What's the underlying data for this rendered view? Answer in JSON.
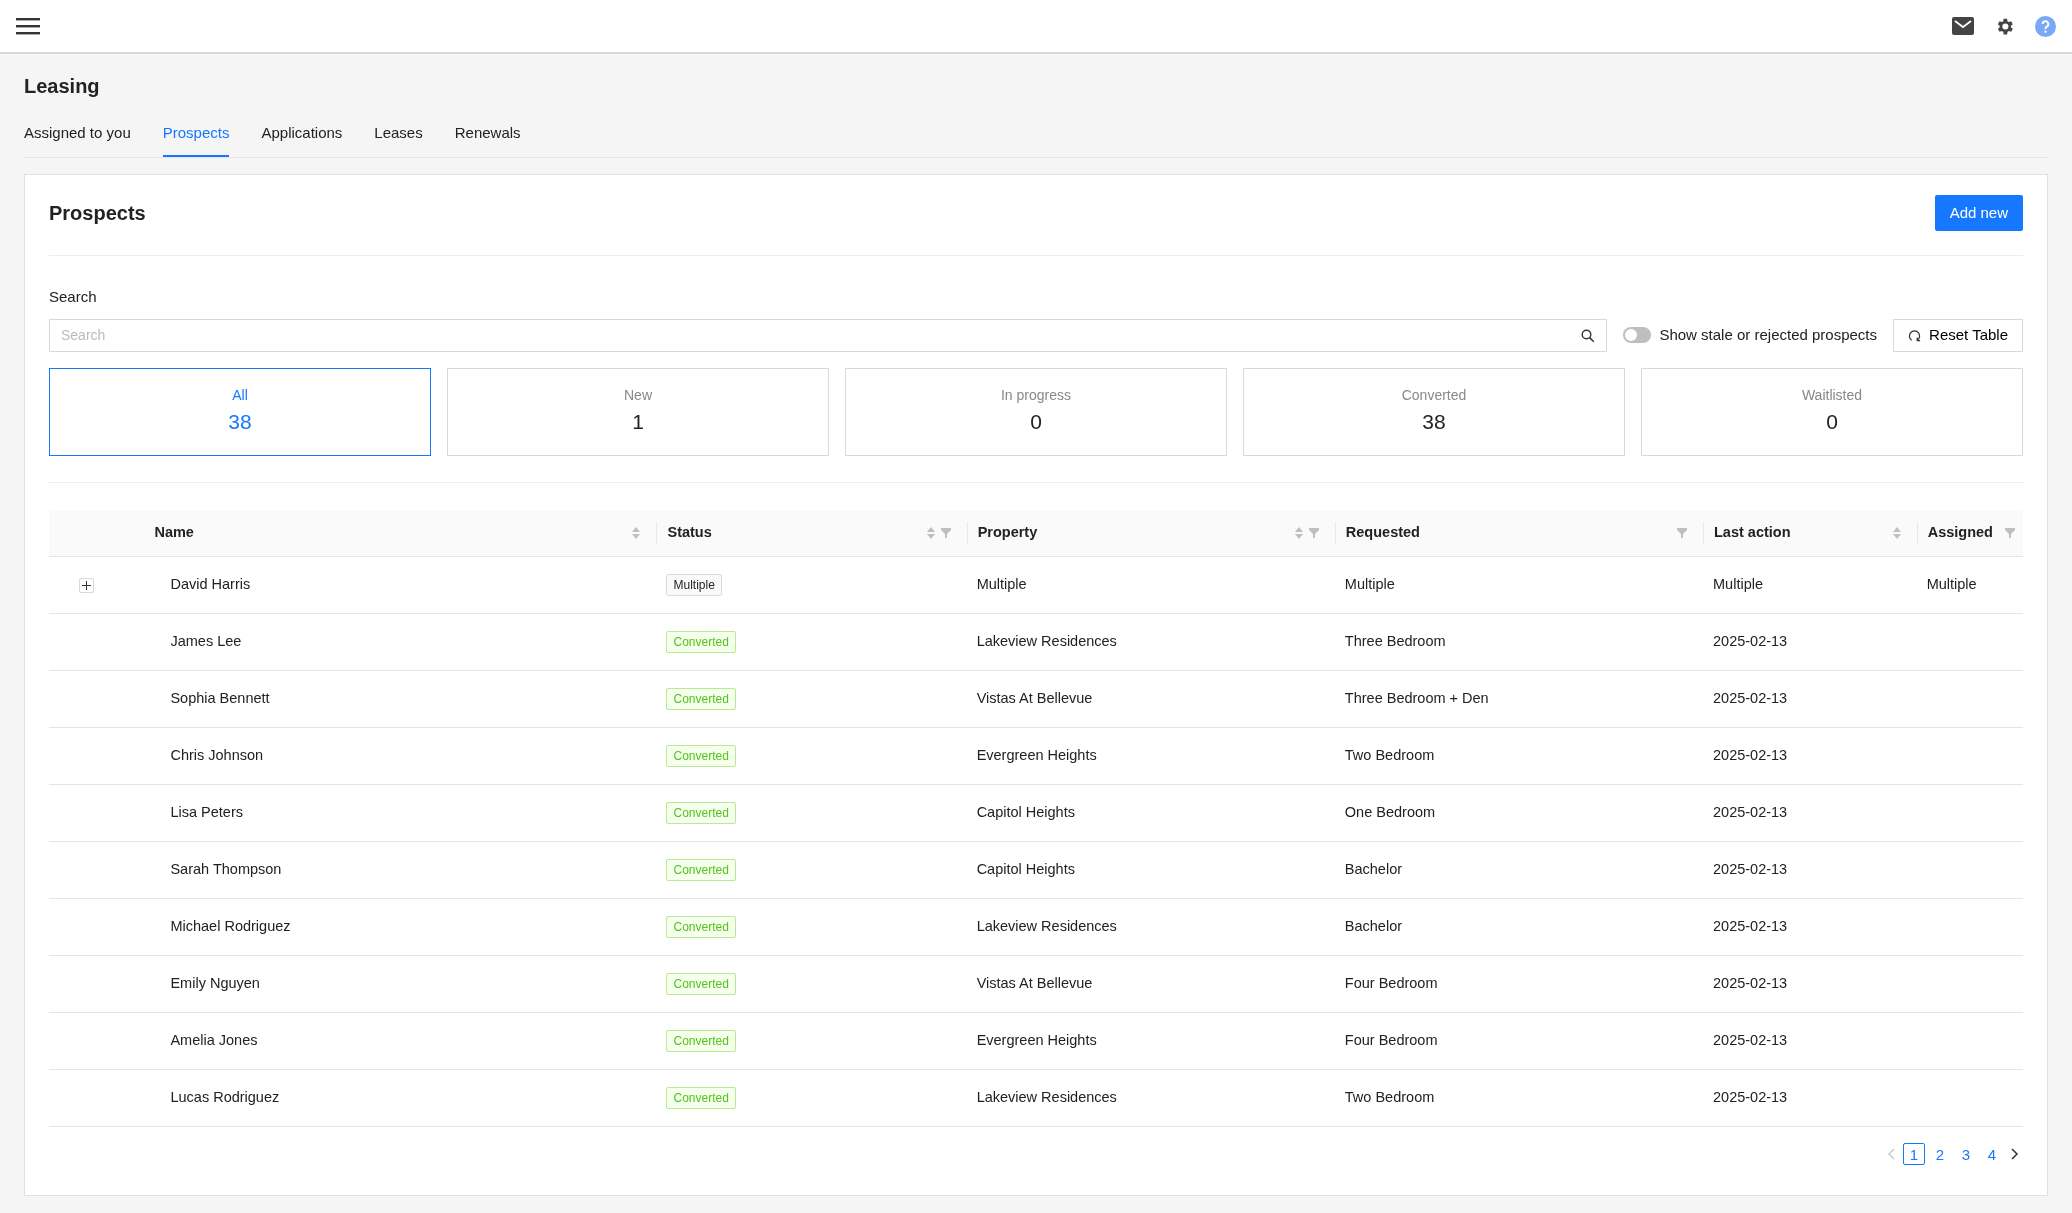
{
  "page_title": "Leasing",
  "tabs": [
    {
      "label": "Assigned to you",
      "selected": false
    },
    {
      "label": "Prospects",
      "selected": true
    },
    {
      "label": "Applications",
      "selected": false
    },
    {
      "label": "Leases",
      "selected": false
    },
    {
      "label": "Renewals",
      "selected": false
    }
  ],
  "panel": {
    "title": "Prospects",
    "add_button": "Add new"
  },
  "search": {
    "label": "Search",
    "placeholder": "Search"
  },
  "stale_toggle": {
    "label": "Show stale or rejected prospects",
    "on": false
  },
  "reset_button": "Reset Table",
  "stats": [
    {
      "label": "All",
      "count": "38",
      "selected": true
    },
    {
      "label": "New",
      "count": "1",
      "selected": false
    },
    {
      "label": "In progress",
      "count": "0",
      "selected": false
    },
    {
      "label": "Converted",
      "count": "38",
      "selected": false
    },
    {
      "label": "Waitlisted",
      "count": "0",
      "selected": false
    }
  ],
  "table": {
    "columns": [
      {
        "label": "Name",
        "sortable": true,
        "filterable": false
      },
      {
        "label": "Status",
        "sortable": true,
        "filterable": true
      },
      {
        "label": "Property",
        "sortable": true,
        "filterable": true
      },
      {
        "label": "Requested",
        "sortable": false,
        "filterable": true
      },
      {
        "label": "Last action",
        "sortable": true,
        "filterable": false
      },
      {
        "label": "Assigned",
        "sortable": false,
        "filterable": true
      }
    ],
    "rows": [
      {
        "expandable": true,
        "name": "David Harris",
        "status": {
          "text": "Multiple",
          "kind": "multiple"
        },
        "property": "Multiple",
        "requested": "Multiple",
        "last_action": "Multiple",
        "assigned": "Multiple"
      },
      {
        "expandable": false,
        "name": "James Lee",
        "status": {
          "text": "Converted",
          "kind": "converted"
        },
        "property": "Lakeview Residences",
        "requested": "Three Bedroom",
        "last_action": "2025-02-13"
      },
      {
        "expandable": false,
        "name": "Sophia Bennett",
        "status": {
          "text": "Converted",
          "kind": "converted"
        },
        "property": "Vistas At Bellevue",
        "requested": "Three Bedroom + Den",
        "last_action": "2025-02-13"
      },
      {
        "expandable": false,
        "name": "Chris Johnson",
        "status": {
          "text": "Converted",
          "kind": "converted"
        },
        "property": "Evergreen Heights",
        "requested": "Two Bedroom",
        "last_action": "2025-02-13"
      },
      {
        "expandable": false,
        "name": "Lisa Peters",
        "status": {
          "text": "Converted",
          "kind": "converted"
        },
        "property": "Capitol Heights",
        "requested": "One Bedroom",
        "last_action": "2025-02-13"
      },
      {
        "expandable": false,
        "name": "Sarah Thompson",
        "status": {
          "text": "Converted",
          "kind": "converted"
        },
        "property": "Capitol Heights",
        "requested": "Bachelor",
        "last_action": "2025-02-13"
      },
      {
        "expandable": false,
        "name": "Michael Rodriguez",
        "status": {
          "text": "Converted",
          "kind": "converted"
        },
        "property": "Lakeview Residences",
        "requested": "Bachelor",
        "last_action": "2025-02-13"
      },
      {
        "expandable": false,
        "name": "Emily Nguyen",
        "status": {
          "text": "Converted",
          "kind": "converted"
        },
        "property": "Vistas At Bellevue",
        "requested": "Four Bedroom",
        "last_action": "2025-02-13"
      },
      {
        "expandable": false,
        "name": "Amelia Jones",
        "status": {
          "text": "Converted",
          "kind": "converted"
        },
        "property": "Evergreen Heights",
        "requested": "Four Bedroom",
        "last_action": "2025-02-13"
      },
      {
        "expandable": false,
        "name": "Lucas Rodriguez",
        "status": {
          "text": "Converted",
          "kind": "converted"
        },
        "property": "Lakeview Residences",
        "requested": "Two Bedroom",
        "last_action": "2025-02-13"
      }
    ]
  },
  "pagination": {
    "prev_disabled": true,
    "pages": [
      {
        "label": "1",
        "selected": true
      },
      {
        "label": "2",
        "selected": false
      },
      {
        "label": "3",
        "selected": false
      },
      {
        "label": "4",
        "selected": false
      }
    ],
    "next_disabled": false
  }
}
